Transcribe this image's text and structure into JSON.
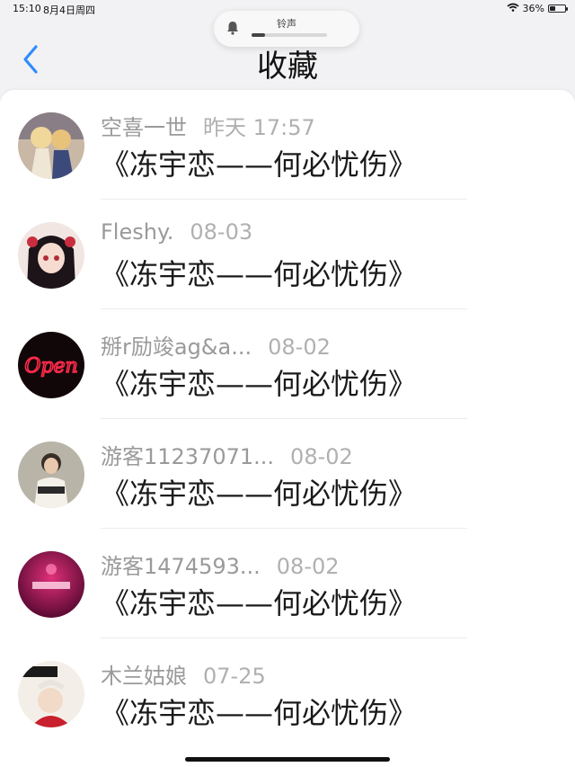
{
  "status_bar": {
    "time": "15:10",
    "date": "8月4日周四",
    "battery_percent": "36%",
    "battery_level": 0.36
  },
  "volume_hud": {
    "label": "铃声",
    "level": 0.18,
    "icon": "bell-icon"
  },
  "nav": {
    "back_icon": "chevron-left-icon",
    "title": "收藏",
    "accent_color": "#2f8cff"
  },
  "favorites": [
    {
      "name": "空喜一世",
      "date": "昨天 17:57",
      "title": "《冻宇恋——何必忧伤》",
      "avatar": "anime-pair-avatar"
    },
    {
      "name": "Fleshy.",
      "date": "08-03",
      "title": "《冻宇恋——何必忧伤》",
      "avatar": "anime-girl-avatar"
    },
    {
      "name": "掰r励竣ag&a...",
      "date": "08-02",
      "title": "《冻宇恋——何必忧伤》",
      "avatar": "neon-open-avatar"
    },
    {
      "name": "游客11237071...",
      "date": "08-02",
      "title": "《冻宇恋——何必忧伤》",
      "avatar": "photo-person-avatar"
    },
    {
      "name": "游客1474593...",
      "date": "08-02",
      "title": "《冻宇恋——何必忧伤》",
      "avatar": "pink-cover-avatar"
    },
    {
      "name": "木兰姑娘",
      "date": "07-25",
      "title": "《冻宇恋——何必忧伤》",
      "avatar": "poster-avatar"
    }
  ]
}
